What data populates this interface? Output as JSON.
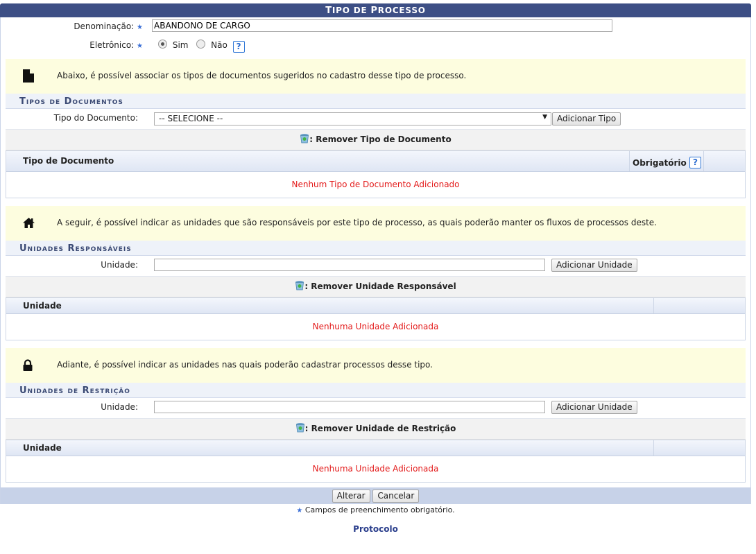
{
  "page": {
    "title_prefix": "T",
    "title_rest": "IPO DE ",
    "title_second": "P",
    "title_second_rest": "ROCESSO"
  },
  "form": {
    "denominacao_label": "Denominação:",
    "denominacao_value": "ABANDONO DE CARGO",
    "eletronico_label": "Eletrônico:",
    "sim_label": "Sim",
    "nao_label": "Não",
    "eletronico_selected": "Sim",
    "help": "?"
  },
  "info_documents": "Abaixo, é possível associar os tipos de documentos sugeridos no cadastro desse tipo de processo.",
  "documents": {
    "header": "Tipos de Documentos",
    "tipo_label": "Tipo do Documento:",
    "tipo_selected": "-- SELECIONE --",
    "add_button": "Adicionar Tipo",
    "legend": ": Remover Tipo de Documento",
    "col_tipo": "Tipo de Documento",
    "col_obrigatorio": "Obrigatório",
    "empty": "Nenhum Tipo de Documento Adicionado"
  },
  "info_responsaveis": "A seguir, é possível indicar as unidades que são responsáveis por este tipo de processo, as quais poderão manter os fluxos de processos deste.",
  "responsaveis": {
    "header": "Unidades Responsáveis",
    "unidade_label": "Unidade:",
    "unidade_value": "",
    "add_button": "Adicionar Unidade",
    "legend": ": Remover Unidade Responsável",
    "col_unidade": "Unidade",
    "empty": "Nenhuma Unidade Adicionada"
  },
  "info_restricao": "Adiante, é possível indicar as unidades nas quais poderão cadastrar processos desse tipo.",
  "restricao": {
    "header": "Unidades de Restrição",
    "unidade_label": "Unidade:",
    "unidade_value": "",
    "add_button": "Adicionar Unidade",
    "legend": ": Remover Unidade de Restrição",
    "col_unidade": "Unidade",
    "empty": "Nenhuma Unidade Adicionada"
  },
  "footer": {
    "alterar": "Alterar",
    "cancelar": "Cancelar",
    "required_note": "Campos de preenchimento obrigatório.",
    "module": "Protocolo"
  },
  "colors": {
    "title_bg": "#3d4f85",
    "info_bg": "#fdfddf",
    "empty_text": "#e31b1b",
    "footer_bg": "#c7d2e8"
  }
}
